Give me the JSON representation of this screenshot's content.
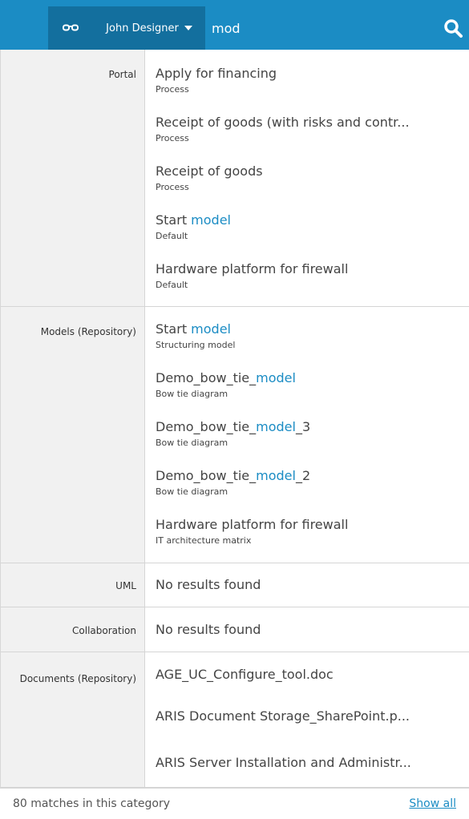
{
  "header": {
    "user_name": "John Designer",
    "search_value": "mod",
    "icons": [
      "glasses-icon",
      "caret-down-icon",
      "search-icon"
    ],
    "colors": {
      "topbar": "#1b8cc4",
      "button": "#136f9e",
      "highlight": "#1b8cc4"
    }
  },
  "sections": {
    "portal": {
      "label": "Portal",
      "results": [
        {
          "before": "Apply for financing",
          "match": "",
          "after": "",
          "type": "Process"
        },
        {
          "before": "Receipt of goods (with risks and contr...",
          "match": "",
          "after": "",
          "type": "Process"
        },
        {
          "before": "Receipt of goods",
          "match": "",
          "after": "",
          "type": "Process"
        },
        {
          "before": "Start ",
          "match": "model",
          "after": "",
          "type": "Default"
        },
        {
          "before": "Hardware platform for firewall",
          "match": "",
          "after": "",
          "type": "Default"
        }
      ]
    },
    "models": {
      "label": "Models (Repository)",
      "results": [
        {
          "before": "Start ",
          "match": "model",
          "after": "",
          "type": "Structuring model"
        },
        {
          "before": "Demo_bow_tie_",
          "match": "model",
          "after": "",
          "type": "Bow tie diagram"
        },
        {
          "before": "Demo_bow_tie_",
          "match": "model",
          "after": "_3",
          "type": "Bow tie diagram"
        },
        {
          "before": "Demo_bow_tie_",
          "match": "model",
          "after": "_2",
          "type": "Bow tie diagram"
        },
        {
          "before": "Hardware platform for firewall",
          "match": "",
          "after": "",
          "type": "IT architecture matrix"
        }
      ]
    },
    "uml": {
      "label": "UML",
      "message": "No results found"
    },
    "collaboration": {
      "label": "Collaboration",
      "message": "No results found"
    },
    "documents": {
      "label": "Documents (Repository)",
      "results": [
        {
          "title": "AGE_UC_Configure_tool.doc"
        },
        {
          "title": "ARIS Document Storage_SharePoint.p..."
        },
        {
          "title": "ARIS Server Installation and Administr..."
        }
      ]
    }
  },
  "footer": {
    "count_text": "80 matches in this category",
    "show_all_label": "Show all"
  }
}
